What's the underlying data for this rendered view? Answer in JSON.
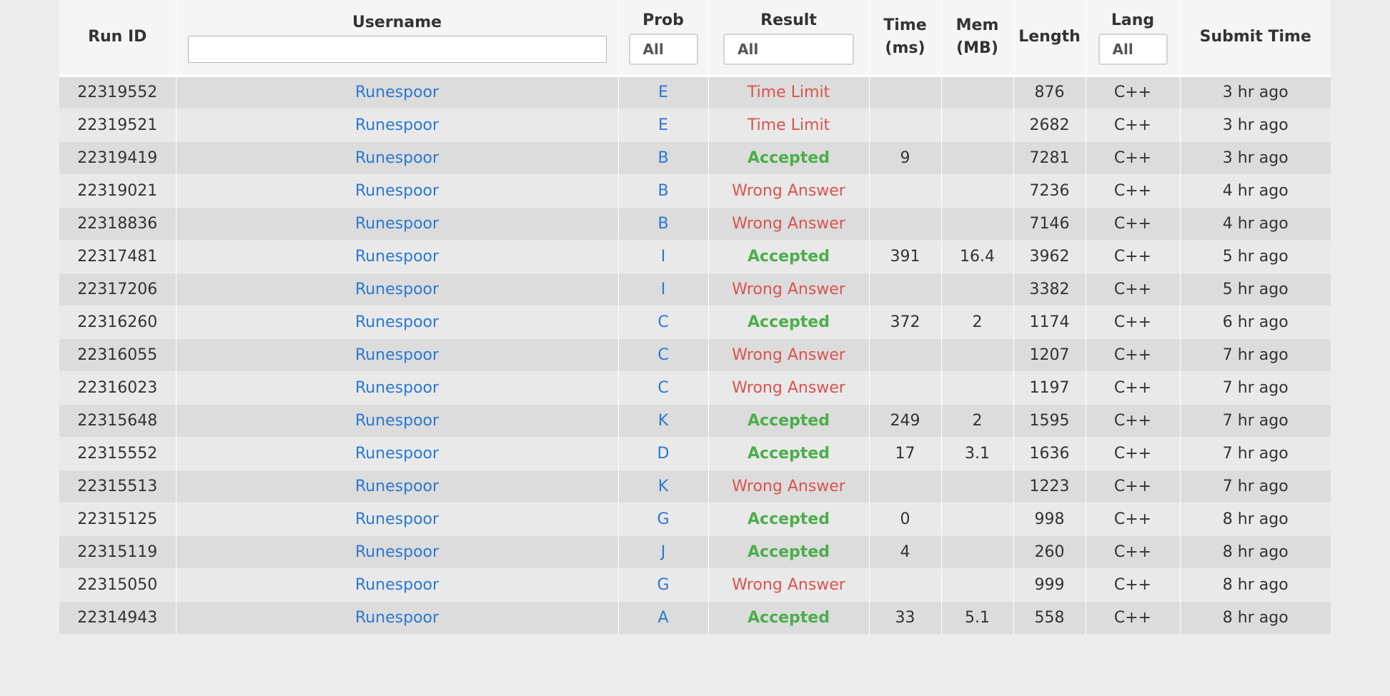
{
  "headers": {
    "run_id": "Run ID",
    "username": "Username",
    "prob": "Prob",
    "result": "Result",
    "time_line1": "Time",
    "time_line2": "(ms)",
    "mem_line1": "Mem",
    "mem_line2": "(MB)",
    "length": "Length",
    "lang": "Lang",
    "submit_time": "Submit Time"
  },
  "filters": {
    "username_value": "",
    "prob_selected": "All",
    "result_selected": "All",
    "lang_selected": "All"
  },
  "colors": {
    "accepted": "#4cae4c",
    "rejected": "#d9534f",
    "link": "#2a78d0"
  },
  "rows": [
    {
      "run_id": "22319552",
      "user": "Runespoor",
      "prob": "E",
      "result": "Time Limit",
      "accepted": false,
      "time": "",
      "mem": "",
      "length": "876",
      "lang": "C++",
      "submit": "3 hr ago"
    },
    {
      "run_id": "22319521",
      "user": "Runespoor",
      "prob": "E",
      "result": "Time Limit",
      "accepted": false,
      "time": "",
      "mem": "",
      "length": "2682",
      "lang": "C++",
      "submit": "3 hr ago"
    },
    {
      "run_id": "22319419",
      "user": "Runespoor",
      "prob": "B",
      "result": "Accepted",
      "accepted": true,
      "time": "9",
      "mem": "",
      "length": "7281",
      "lang": "C++",
      "submit": "3 hr ago"
    },
    {
      "run_id": "22319021",
      "user": "Runespoor",
      "prob": "B",
      "result": "Wrong Answer",
      "accepted": false,
      "time": "",
      "mem": "",
      "length": "7236",
      "lang": "C++",
      "submit": "4 hr ago"
    },
    {
      "run_id": "22318836",
      "user": "Runespoor",
      "prob": "B",
      "result": "Wrong Answer",
      "accepted": false,
      "time": "",
      "mem": "",
      "length": "7146",
      "lang": "C++",
      "submit": "4 hr ago"
    },
    {
      "run_id": "22317481",
      "user": "Runespoor",
      "prob": "I",
      "result": "Accepted",
      "accepted": true,
      "time": "391",
      "mem": "16.4",
      "length": "3962",
      "lang": "C++",
      "submit": "5 hr ago"
    },
    {
      "run_id": "22317206",
      "user": "Runespoor",
      "prob": "I",
      "result": "Wrong Answer",
      "accepted": false,
      "time": "",
      "mem": "",
      "length": "3382",
      "lang": "C++",
      "submit": "5 hr ago"
    },
    {
      "run_id": "22316260",
      "user": "Runespoor",
      "prob": "C",
      "result": "Accepted",
      "accepted": true,
      "time": "372",
      "mem": "2",
      "length": "1174",
      "lang": "C++",
      "submit": "6 hr ago"
    },
    {
      "run_id": "22316055",
      "user": "Runespoor",
      "prob": "C",
      "result": "Wrong Answer",
      "accepted": false,
      "time": "",
      "mem": "",
      "length": "1207",
      "lang": "C++",
      "submit": "7 hr ago"
    },
    {
      "run_id": "22316023",
      "user": "Runespoor",
      "prob": "C",
      "result": "Wrong Answer",
      "accepted": false,
      "time": "",
      "mem": "",
      "length": "1197",
      "lang": "C++",
      "submit": "7 hr ago"
    },
    {
      "run_id": "22315648",
      "user": "Runespoor",
      "prob": "K",
      "result": "Accepted",
      "accepted": true,
      "time": "249",
      "mem": "2",
      "length": "1595",
      "lang": "C++",
      "submit": "7 hr ago"
    },
    {
      "run_id": "22315552",
      "user": "Runespoor",
      "prob": "D",
      "result": "Accepted",
      "accepted": true,
      "time": "17",
      "mem": "3.1",
      "length": "1636",
      "lang": "C++",
      "submit": "7 hr ago"
    },
    {
      "run_id": "22315513",
      "user": "Runespoor",
      "prob": "K",
      "result": "Wrong Answer",
      "accepted": false,
      "time": "",
      "mem": "",
      "length": "1223",
      "lang": "C++",
      "submit": "7 hr ago"
    },
    {
      "run_id": "22315125",
      "user": "Runespoor",
      "prob": "G",
      "result": "Accepted",
      "accepted": true,
      "time": "0",
      "mem": "",
      "length": "998",
      "lang": "C++",
      "submit": "8 hr ago"
    },
    {
      "run_id": "22315119",
      "user": "Runespoor",
      "prob": "J",
      "result": "Accepted",
      "accepted": true,
      "time": "4",
      "mem": "",
      "length": "260",
      "lang": "C++",
      "submit": "8 hr ago"
    },
    {
      "run_id": "22315050",
      "user": "Runespoor",
      "prob": "G",
      "result": "Wrong Answer",
      "accepted": false,
      "time": "",
      "mem": "",
      "length": "999",
      "lang": "C++",
      "submit": "8 hr ago"
    },
    {
      "run_id": "22314943",
      "user": "Runespoor",
      "prob": "A",
      "result": "Accepted",
      "accepted": true,
      "time": "33",
      "mem": "5.1",
      "length": "558",
      "lang": "C++",
      "submit": "8 hr ago"
    }
  ]
}
